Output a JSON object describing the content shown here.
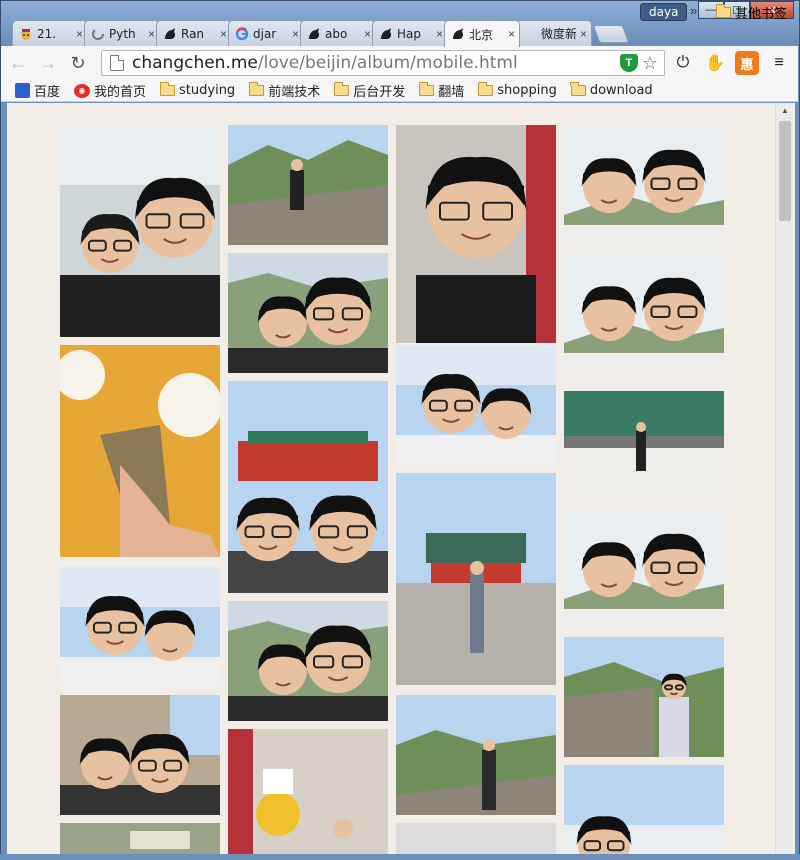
{
  "window": {
    "user_name": "daya",
    "minimize_label": "—",
    "maximize_label": "☐",
    "close_label": "✕"
  },
  "tabs": [
    {
      "title": "21.",
      "favicon": "cartoon-avatar-icon",
      "active": false
    },
    {
      "title": "Pyth",
      "favicon": "spinner-icon",
      "active": false
    },
    {
      "title": "Ran",
      "favicon": "rooster-icon",
      "active": false
    },
    {
      "title": "djar",
      "favicon": "google-icon",
      "active": false
    },
    {
      "title": "abo",
      "favicon": "rooster-icon",
      "active": false
    },
    {
      "title": "Hap",
      "favicon": "rooster-icon",
      "active": false
    },
    {
      "title": "北京",
      "favicon": "rooster-icon",
      "active": true
    },
    {
      "title": "微度新",
      "favicon": "blank-page-icon",
      "active": false
    }
  ],
  "tab_close_glyph": "×",
  "toolbar": {
    "back_glyph": "←",
    "forward_glyph": "→",
    "reload_glyph": "↻",
    "url_host": "changchen.me",
    "url_path": "/love/beijin/album/mobile.html",
    "shield_glyph": "T",
    "star_glyph": "☆",
    "power_glyph": "⏻",
    "hand_glyph": "✋",
    "ext_glyph": "惠",
    "menu_glyph": "≡"
  },
  "bookmarks": {
    "items": [
      {
        "label": "百度",
        "icon": "baidu-paw-icon"
      },
      {
        "label": "我的首页",
        "icon": "weibo-icon"
      },
      {
        "label": "studying",
        "icon": "folder-icon"
      },
      {
        "label": "前端技术",
        "icon": "folder-icon"
      },
      {
        "label": "后台开发",
        "icon": "folder-icon"
      },
      {
        "label": "翻墙",
        "icon": "folder-icon"
      },
      {
        "label": "shopping",
        "icon": "folder-icon"
      },
      {
        "label": "download",
        "icon": "folder-icon"
      }
    ],
    "more_glyph": "»",
    "other_label": "其他书签"
  },
  "album": {
    "columns": 4,
    "photos": [
      {
        "scene": "selfie-train",
        "col": 0
      },
      {
        "scene": "great-wall-pose",
        "col": 1
      },
      {
        "scene": "girl-closeup",
        "col": 2
      },
      {
        "scene": "couple-mountain-selfie",
        "col": 3
      },
      {
        "scene": "couple-wall-selfie",
        "col": 1
      },
      {
        "scene": "couple-mountain-selfie",
        "col": 3
      },
      {
        "scene": "food-roll",
        "col": 0
      },
      {
        "scene": "couple-sky-selfie",
        "col": 2
      },
      {
        "scene": "gate-selfie",
        "col": 1
      },
      {
        "scene": "wall-green-statues",
        "col": 3
      },
      {
        "scene": "boy-gate",
        "col": 2
      },
      {
        "scene": "couple-sky-selfie-2",
        "col": 3
      },
      {
        "scene": "couple-sky-selfie",
        "col": 0
      },
      {
        "scene": "couple-wall-selfie-2",
        "col": 1
      },
      {
        "scene": "great-wall-boy",
        "col": 3
      },
      {
        "scene": "great-wall-boy-2",
        "col": 2
      },
      {
        "scene": "street-selfie",
        "col": 0
      },
      {
        "scene": "duck-mascot",
        "col": 1
      },
      {
        "scene": "girl-sky",
        "col": 3
      },
      {
        "scene": "wall-sign",
        "col": 0
      },
      {
        "scene": "partial",
        "col": 2
      }
    ]
  },
  "scrollbar": {
    "up_glyph": "▲",
    "position_fraction": 0.0
  }
}
